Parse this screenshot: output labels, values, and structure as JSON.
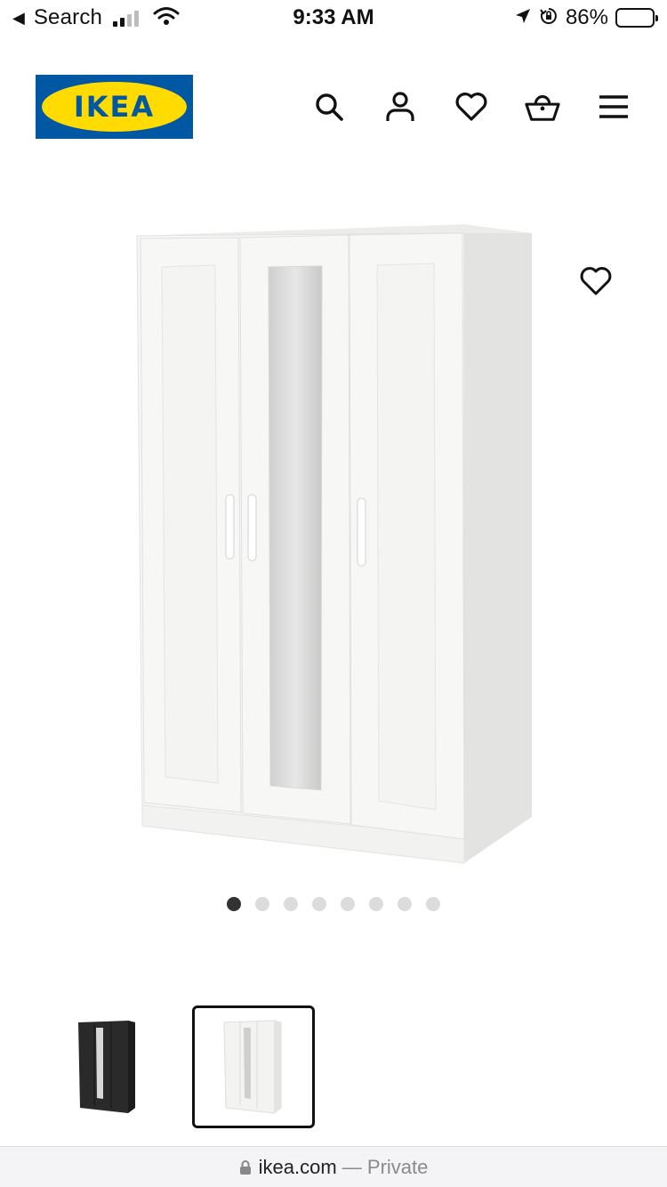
{
  "status_bar": {
    "back_label": "Search",
    "time": "9:33 AM",
    "battery_percent": "86%",
    "battery_level": 0.86,
    "signal_bars": 2,
    "icons": [
      "back-arrow-icon",
      "signal-icon",
      "wifi-icon",
      "location-icon",
      "orientation-lock-icon",
      "battery-icon"
    ]
  },
  "header": {
    "logo_text": "IKEA",
    "logo_registered": "®",
    "brand_colors": {
      "blue": "#0058a3",
      "yellow": "#ffdb00"
    },
    "icons": [
      "search-icon",
      "account-icon",
      "wishlist-heart-icon",
      "shopping-basket-icon",
      "menu-icon"
    ]
  },
  "product": {
    "image": "white-three-door-wardrobe-with-mirror",
    "favorite_icon": "heart-outline-icon",
    "gallery": {
      "total_images": 8,
      "active_index": 0
    }
  },
  "variants": [
    {
      "name": "black-wardrobe-variant",
      "color": "#2a2a2a",
      "selected": false
    },
    {
      "name": "white-wardrobe-variant",
      "color": "#f3f3f1",
      "selected": true
    }
  ],
  "browser": {
    "domain": "ikea.com",
    "separator": " — ",
    "mode": "Private"
  }
}
